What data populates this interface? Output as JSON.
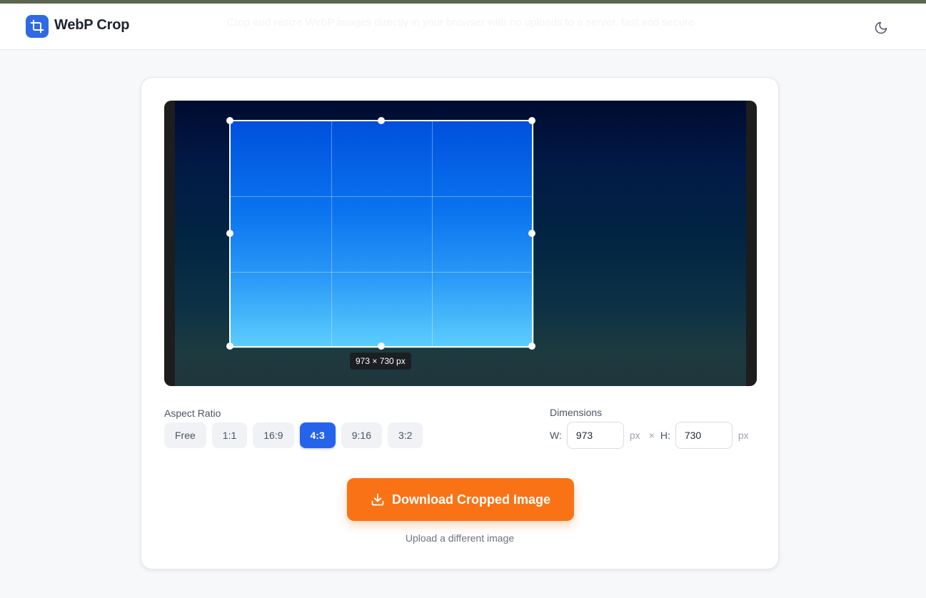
{
  "app": {
    "name": "WebP Crop",
    "tagline": "Crop and resize WebP images directly in your browser with no uploads to a server, fast and secure"
  },
  "header": {
    "logo_icon": "crop-icon",
    "theme_icon": "moon-icon"
  },
  "crop": {
    "size_label": "973 × 730 px"
  },
  "aspect_ratio": {
    "label": "Aspect Ratio",
    "options": [
      "Free",
      "1:1",
      "16:9",
      "4:3",
      "9:16",
      "3:2"
    ],
    "selected": "4:3"
  },
  "dimensions": {
    "label": "Dimensions",
    "width_label": "W:",
    "width_value": "973",
    "height_label": "H:",
    "height_value": "730",
    "unit": "px",
    "separator": "×"
  },
  "actions": {
    "download_label": "Download Cropped Image",
    "download_icon": "download-icon",
    "upload_label": "Upload a different image"
  },
  "colors": {
    "brand_blue": "#2563eb",
    "download_orange": "#f97316"
  }
}
